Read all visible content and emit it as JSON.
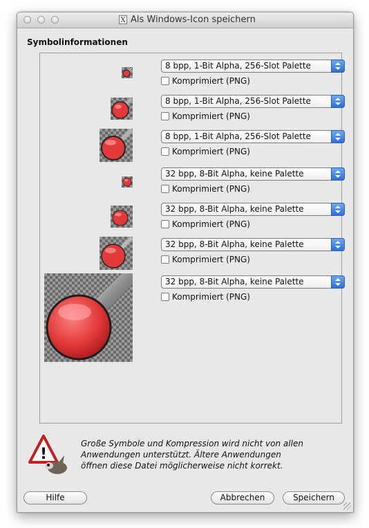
{
  "window": {
    "title": "Als Windows-Icon speichern",
    "app_glyph": "X"
  },
  "section_title": "Symbolinformationen",
  "icon_rows": [
    {
      "format": "8 bpp, 1-Bit Alpha, 256-Slot Palette",
      "compress_label": "Komprimiert (PNG)",
      "compressed": false
    },
    {
      "format": "8 bpp, 1-Bit Alpha, 256-Slot Palette",
      "compress_label": "Komprimiert (PNG)",
      "compressed": false
    },
    {
      "format": "8 bpp, 1-Bit Alpha, 256-Slot Palette",
      "compress_label": "Komprimiert (PNG)",
      "compressed": false
    },
    {
      "format": "32 bpp, 8-Bit Alpha, keine Palette",
      "compress_label": "Komprimiert (PNG)",
      "compressed": false
    },
    {
      "format": "32 bpp, 8-Bit Alpha, keine Palette",
      "compress_label": "Komprimiert (PNG)",
      "compressed": false
    },
    {
      "format": "32 bpp, 8-Bit Alpha, keine Palette",
      "compress_label": "Komprimiert (PNG)",
      "compressed": false
    },
    {
      "format": "32 bpp, 8-Bit Alpha, keine Palette",
      "compress_label": "Komprimiert (PNG)",
      "compressed": false
    }
  ],
  "warning": {
    "icon": "warning-wilber-icon",
    "lines": [
      "Große Symbole und Kompression wird nicht von allen",
      "Anwendungen unterstützt. Ältere Anwendungen",
      "öffnen diese Datei möglicherweise nicht korrekt."
    ]
  },
  "buttons": {
    "help": "Hilfe",
    "cancel": "Abbrechen",
    "save": "Speichern"
  },
  "colors": {
    "accent": "#2f6fd6",
    "icon_red": "#e23a3a"
  }
}
